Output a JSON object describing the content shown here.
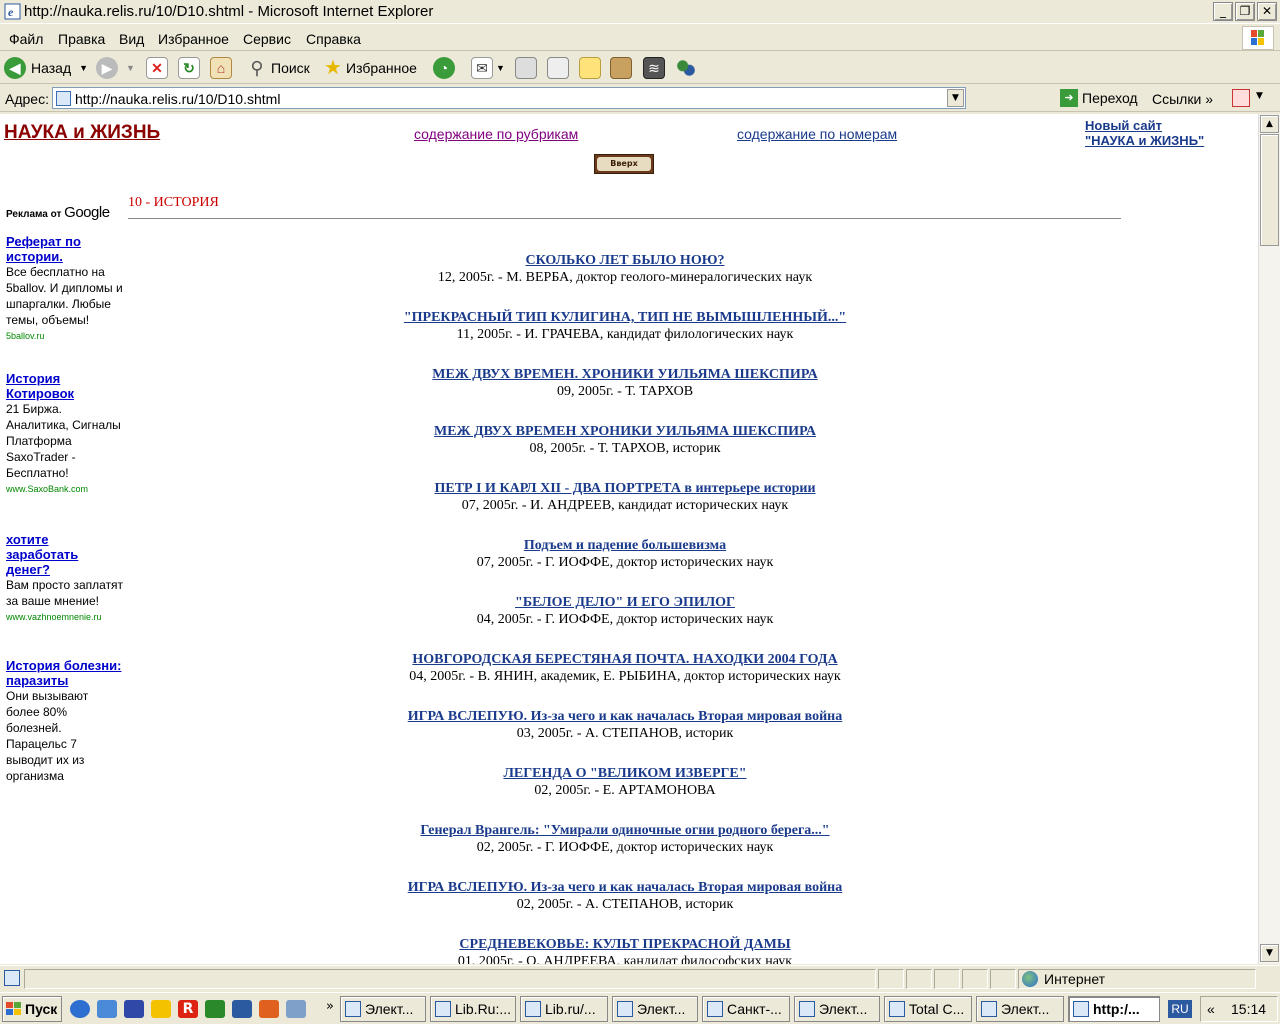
{
  "window": {
    "title": "http://nauka.relis.ru/10/D10.shtml - Microsoft Internet Explorer"
  },
  "menu": [
    "Файл",
    "Правка",
    "Вид",
    "Избранное",
    "Сервис",
    "Справка"
  ],
  "toolbar": {
    "back": "Назад",
    "search": "Поиск",
    "favorites": "Избранное"
  },
  "address": {
    "label": "Адрес:",
    "url": "http://nauka.relis.ru/10/D10.shtml",
    "go": "Переход",
    "links": "Ссылки"
  },
  "page": {
    "site_title": "НАУКА и ЖИЗНЬ",
    "rubrics_link": "содержание по рубрикам",
    "issues_link": "содержание по номерам",
    "new_site_1": "Новый сайт",
    "new_site_2": "\"НАУКА и ЖИЗНЬ\"",
    "up_button": "Вверх",
    "section": "10 - ИСТОРИЯ",
    "ads_by": "Реклама от",
    "ads_brand": "Google",
    "ads": [
      {
        "title": "Реферат по истории.",
        "text": "Все бесплатно на 5ballov. И дипломы и шпаргалки. Любые темы, объемы!",
        "url": "5ballov.ru"
      },
      {
        "title": "История Котировок",
        "text": "21 Биржа. Аналитика, Сигналы Платформа SaxoTrader - Бесплатно!",
        "url": "www.SaxoBank.com"
      },
      {
        "title": "хотите заработать денег?",
        "text": "Вам просто заплатят за ваше мнение!",
        "url": "www.vazhnoemnenie.ru"
      },
      {
        "title": "История болезни: паразиты",
        "text": "Они вызывают более 80% болезней. Парацельс 7 выводит их из организма",
        "url": ""
      }
    ],
    "articles": [
      {
        "title": "СКОЛЬКО ЛЕТ БЫЛО НОЮ?",
        "meta": "12, 2005г. - М. ВЕРБА, доктор геолого-минералогических наук"
      },
      {
        "title": "\"ПРЕКРАСНЫЙ ТИП КУЛИГИНА, ТИП НЕ ВЫМЫШЛЕННЫЙ...\"",
        "meta": "11, 2005г. - И. ГРАЧЕВА, кандидат филологических наук"
      },
      {
        "title": "МЕЖ ДВУХ ВРЕМЕН. ХРОНИКИ УИЛЬЯМА ШЕКСПИРА",
        "meta": "09, 2005г. - Т. ТАРХОВ"
      },
      {
        "title": "МЕЖ ДВУХ ВРЕМЕН ХРОНИКИ УИЛЬЯМА ШЕКСПИРА",
        "meta": "08, 2005г. - Т. ТАРХОВ, историк"
      },
      {
        "title": "ПЕТР I И КАРЛ XII - ДВА ПОРТРЕТА в интерьере истории",
        "meta": "07, 2005г. - И. АНДРЕЕВ, кандидат исторических наук"
      },
      {
        "title": "Подъем и падение большевизма",
        "meta": "07, 2005г. - Г. ИОФФЕ, доктор исторических наук"
      },
      {
        "title": "\"БЕЛОЕ ДЕЛО\" И ЕГО ЭПИЛОГ",
        "meta": "04, 2005г. - Г. ИОФФЕ, доктор исторических наук"
      },
      {
        "title": "НОВГОРОДСКАЯ БЕРЕСТЯНАЯ ПОЧТА. НАХОДКИ 2004 ГОДА",
        "meta": "04, 2005г. - В. ЯНИН, академик, Е. РЫБИНА, доктор исторических наук"
      },
      {
        "title": "ИГРА ВСЛЕПУЮ. Из-за чего и как началась Вторая мировая война",
        "meta": "03, 2005г. - А. СТЕПАНОВ, историк"
      },
      {
        "title": "ЛЕГЕНДА О \"ВЕЛИКОМ ИЗВЕРГЕ\"",
        "meta": "02, 2005г. - Е. АРТАМОНОВА"
      },
      {
        "title": "Генерал Врангель: \"Умирали одиночные огни родного берега...\"",
        "meta": "02, 2005г. - Г. ИОФФЕ, доктор исторических наук"
      },
      {
        "title": "ИГРА ВСЛЕПУЮ. Из-за чего и как началась Вторая мировая война",
        "meta": "02, 2005г. - А. СТЕПАНОВ, историк"
      },
      {
        "title": "СРЕДНЕВЕКОВЬЕ: КУЛЬТ ПРЕКРАСНОЙ ДАМЫ",
        "meta": "01, 2005г. - О. АНДРЕЕВА, кандидат философских наук"
      }
    ]
  },
  "status": {
    "zone": "Интернет"
  },
  "taskbar": {
    "start": "Пуск",
    "tasks": [
      "Элект...",
      "Lib.Ru:...",
      "Lib.ru/...",
      "Элект...",
      "Санкт-...",
      "Элект...",
      "Total C...",
      "Элект...",
      "http:/..."
    ],
    "lang": "RU",
    "clock": "15:14"
  },
  "colors": {
    "site_title": "#8b0000",
    "article_link": "#1a3a8b",
    "section": "#cc0000",
    "ad_url": "#008800",
    "visited": "#800080"
  }
}
